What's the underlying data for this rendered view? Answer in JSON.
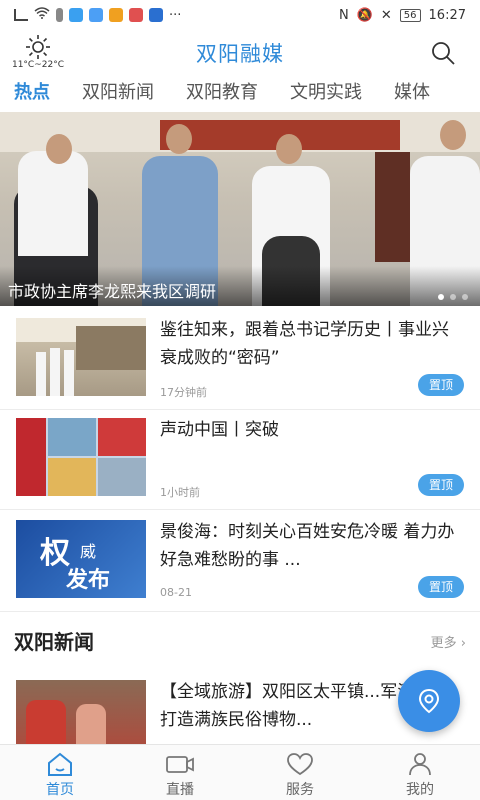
{
  "status": {
    "time": "16:27",
    "battery": "56"
  },
  "header": {
    "title": "双阳融媒",
    "temp": "11°C~22°C"
  },
  "tabs": [
    {
      "label": "热点",
      "active": true
    },
    {
      "label": "双阳新闻"
    },
    {
      "label": "双阳教育"
    },
    {
      "label": "文明实践"
    },
    {
      "label": "媒体"
    }
  ],
  "banner": {
    "caption": "市政协主席李龙熙来我区调研"
  },
  "news": [
    {
      "title": "鉴往知来，跟着总书记学历史丨事业兴衰成败的“密码”",
      "time": "17分钟前",
      "pin": "置顶"
    },
    {
      "title": "声动中国丨突破",
      "time": "1小时前",
      "pin": "置顶"
    },
    {
      "title": "景俊海：时刻关心百姓安危冷暖 着力办好急难愁盼的事 ...",
      "time": "08-21",
      "pin": "置顶"
    },
    {
      "title": "【全域旅游】双阳区太平镇...军满族村打造满族民俗博物..."
    }
  ],
  "thumb3": {
    "line1": "权",
    "line2a": "威",
    "line2b": "发布"
  },
  "section": {
    "label": "双阳新闻",
    "more": "更多"
  },
  "bottom_nav": [
    {
      "label": "首页",
      "active": true
    },
    {
      "label": "直播"
    },
    {
      "label": "服务"
    },
    {
      "label": "我的"
    }
  ]
}
